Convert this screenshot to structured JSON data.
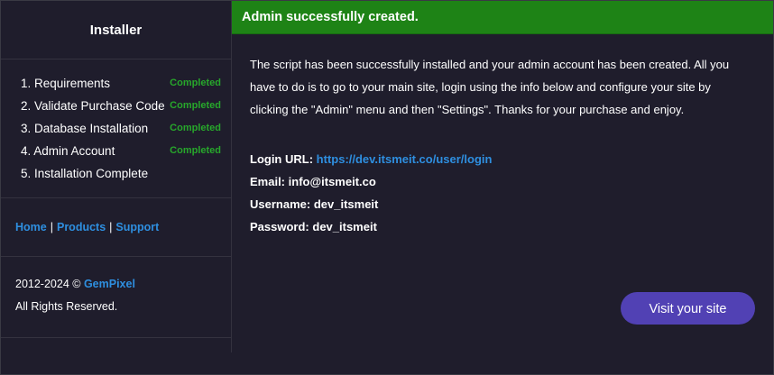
{
  "sidebar": {
    "title": "Installer",
    "steps": [
      {
        "label": "1. Requirements",
        "status": "Completed"
      },
      {
        "label": "2. Validate Purchase Code",
        "status": "Completed"
      },
      {
        "label": "3. Database Installation",
        "status": "Completed"
      },
      {
        "label": "4. Admin Account",
        "status": "Completed"
      },
      {
        "label": "5. Installation Complete",
        "status": ""
      }
    ],
    "links": {
      "home": "Home",
      "products": "Products",
      "support": "Support",
      "separator": "|"
    },
    "copyright": {
      "years": "2012-2024 ©",
      "brand": "GemPixel",
      "rights": "All Rights Reserved."
    }
  },
  "main": {
    "banner": "Admin successfully created.",
    "intro": "The script has been successfully installed and your admin account has been created. All you have to do is to go to your main site, login using the info below and configure your site by clicking the \"Admin\" menu and then \"Settings\". Thanks for your purchase and enjoy.",
    "credentials": {
      "login_label": "Login URL:",
      "login_url": "https://dev.itsmeit.co/user/login",
      "email_label": "Email:",
      "email": "info@itsmeit.co",
      "username_label": "Username:",
      "username": "dev_itsmeit",
      "password_label": "Password:",
      "password": "dev_itsmeit"
    },
    "visit_button": "Visit your site"
  },
  "colors": {
    "background": "#1f1d2c",
    "success_banner": "#1e8316",
    "status_green": "#27a72b",
    "link_blue": "#2e8fe0",
    "button_purple": "#5141b4"
  }
}
